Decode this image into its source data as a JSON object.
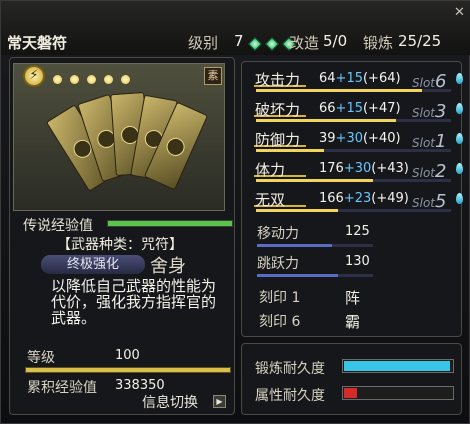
{
  "header": {
    "item_name": "常天磐符",
    "level_label": "级别",
    "level_value": "7",
    "mod_label": "改造",
    "mod_value": "5/0",
    "refine_label": "锻炼",
    "refine_value": "25/25",
    "close_glyph": "✕",
    "gem_color": "#2fb86a"
  },
  "left": {
    "tag_text": "素",
    "stars_count": 5,
    "exp_label": "传说经验值",
    "exp_fraction": 1.0,
    "weapon_type": "【武器种类：咒符】",
    "ultimate_label": "终极强化",
    "ultimate_skill": "舍身",
    "description": "以降低自己武器的性能为代价，强化我方指挥官的武器。",
    "level_label": "等级",
    "level_value": "100",
    "accum_exp_label": "累积经验值",
    "accum_exp_value": "338350",
    "info_switch_label": "信息切换",
    "info_switch_arrow": "▶"
  },
  "stats": [
    {
      "name": "攻击力",
      "base": "64",
      "plus": "+15",
      "extra": "(+64)",
      "slot": "6",
      "fill": 0.85
    },
    {
      "name": "破坏力",
      "base": "66",
      "plus": "+15",
      "extra": "(+47)",
      "slot": "3",
      "fill": 0.72
    },
    {
      "name": "防御力",
      "base": "39",
      "plus": "+30",
      "extra": "(+40)",
      "slot": "1",
      "fill": 0.35
    },
    {
      "name": "体力",
      "base": "176",
      "plus": "+30",
      "extra": "(+43)",
      "slot": "2",
      "fill": 0.6
    },
    {
      "name": "无双",
      "base": "166",
      "plus": "+23",
      "extra": "(+49)",
      "slot": "5",
      "fill": 0.42
    }
  ],
  "slot_label": "Slot",
  "stats2": [
    {
      "name": "移动力",
      "value": "125",
      "fill": 0.65
    },
    {
      "name": "跳跃力",
      "value": "130",
      "fill": 0.7
    }
  ],
  "engrave": [
    {
      "name": "刻印 1",
      "value": "阵"
    },
    {
      "name": "刻印 6",
      "value": "霸"
    }
  ],
  "durability": [
    {
      "name": "锻炼耐久度",
      "fill": 0.98,
      "color": "#39c6e6"
    },
    {
      "name": "属性耐久度",
      "fill": 0.12,
      "color": "#d42a2a"
    }
  ]
}
